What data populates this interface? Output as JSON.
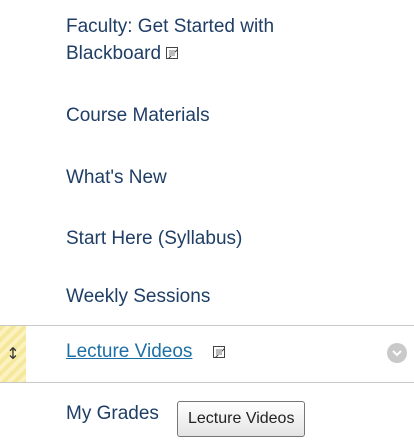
{
  "course_menu": {
    "items": [
      {
        "label_line1": "Faculty: Get Started with",
        "label_line2": "Blackboard",
        "external_icon": "external-link-icon"
      },
      {
        "label": "Course Materials"
      },
      {
        "label": "What's New"
      },
      {
        "label": "Start Here (Syllabus)"
      },
      {
        "label": "Weekly Sessions"
      },
      {
        "label": "Lecture Videos",
        "external_icon": "external-link-icon",
        "drag_icon": "up-down-arrow-icon",
        "context_icon": "chevron-down-icon"
      },
      {
        "label": "My Grades"
      }
    ],
    "tooltip": "Lecture Videos",
    "drag_glyph": "↕"
  }
}
